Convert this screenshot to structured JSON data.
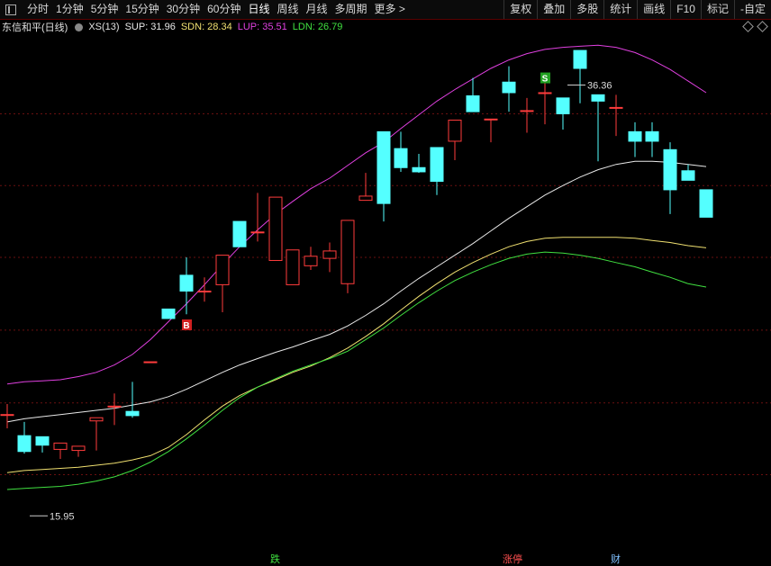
{
  "toolbar": {
    "periods": [
      "分时",
      "1分钟",
      "5分钟",
      "15分钟",
      "30分钟",
      "60分钟",
      "日线",
      "周线",
      "月线",
      "多周期",
      "更多 >"
    ],
    "active_index": 6,
    "right_buttons": [
      "复权",
      "叠加",
      "多股",
      "统计",
      "画线",
      "F10",
      "标记",
      "-自定"
    ]
  },
  "info": {
    "stock": "东信和平(日线)",
    "indicator": "XS(13)",
    "sup": "SUP: 31.96",
    "sdn": "SDN: 28.34",
    "lup": "LUP: 35.51",
    "ldn": "LDN: 26.79",
    "colors": {
      "sup": "#e8e8e8",
      "sdn": "#f0e070",
      "lup": "#e040e0",
      "ldn": "#40e040"
    }
  },
  "bottom_marks": {
    "a": "跌",
    "b": "涨停",
    "c": "财"
  },
  "chart_data": {
    "type": "candlestick",
    "ylim": [
      14.3,
      38.6
    ],
    "candles": [
      {
        "o": 20.75,
        "h": 21.25,
        "l": 20.1,
        "c": 20.75
      },
      {
        "o": 19.75,
        "h": 20.4,
        "l": 18.9,
        "c": 19.0
      },
      {
        "o": 19.7,
        "h": 19.7,
        "l": 18.95,
        "c": 19.3
      },
      {
        "o": 19.1,
        "h": 19.4,
        "l": 18.65,
        "c": 19.4
      },
      {
        "o": 19.05,
        "h": 19.25,
        "l": 18.75,
        "c": 19.25
      },
      {
        "o": 20.45,
        "h": 20.45,
        "l": 19.05,
        "c": 20.6
      },
      {
        "o": 21.15,
        "h": 21.75,
        "l": 20.25,
        "c": 21.15
      },
      {
        "o": 20.9,
        "h": 22.3,
        "l": 20.6,
        "c": 20.7
      },
      {
        "o": 23.25,
        "h": 23.25,
        "l": 23.25,
        "c": 23.25
      },
      {
        "o": 25.75,
        "h": 25.75,
        "l": 25.3,
        "c": 25.3
      },
      {
        "o": 27.35,
        "h": 28.2,
        "l": 25.5,
        "c": 26.6
      },
      {
        "o": 26.6,
        "h": 27.25,
        "l": 26.1,
        "c": 26.6
      },
      {
        "o": 26.9,
        "h": 27.85,
        "l": 25.6,
        "c": 28.3
      },
      {
        "o": 29.9,
        "h": 29.9,
        "l": 28.7,
        "c": 28.7
      },
      {
        "o": 29.4,
        "h": 31.25,
        "l": 28.95,
        "c": 29.4
      },
      {
        "o": 28.05,
        "h": 28.05,
        "l": 28.05,
        "c": 31.05
      },
      {
        "o": 26.9,
        "h": 28.55,
        "l": 26.9,
        "c": 28.55
      },
      {
        "o": 27.8,
        "h": 28.7,
        "l": 27.6,
        "c": 28.25
      },
      {
        "o": 28.15,
        "h": 28.9,
        "l": 27.5,
        "c": 28.5
      },
      {
        "o": 26.95,
        "h": 29.9,
        "l": 26.5,
        "c": 29.95
      },
      {
        "o": 30.9,
        "h": 32.2,
        "l": 30.9,
        "c": 31.1
      },
      {
        "o": 34.15,
        "h": 34.15,
        "l": 29.9,
        "c": 30.75
      },
      {
        "o": 33.35,
        "h": 34.15,
        "l": 32.25,
        "c": 32.45
      },
      {
        "o": 32.45,
        "h": 33.1,
        "l": 32.2,
        "c": 32.25
      },
      {
        "o": 33.4,
        "h": 33.4,
        "l": 31.15,
        "c": 31.8
      },
      {
        "o": 33.7,
        "h": 34.55,
        "l": 32.8,
        "c": 34.7
      },
      {
        "o": 35.85,
        "h": 36.7,
        "l": 35.85,
        "c": 35.1
      },
      {
        "o": 34.75,
        "h": 34.75,
        "l": 33.65,
        "c": 34.75
      },
      {
        "o": 36.5,
        "h": 37.25,
        "l": 35.1,
        "c": 36.0
      },
      {
        "o": 35.15,
        "h": 35.75,
        "l": 34.1,
        "c": 35.15
      },
      {
        "o": 36.0,
        "h": 36.65,
        "l": 34.5,
        "c": 36.0
      },
      {
        "o": 35.75,
        "h": 35.75,
        "l": 34.25,
        "c": 35.0
      },
      {
        "o": 38.0,
        "h": 38.0,
        "l": 35.5,
        "c": 37.15
      },
      {
        "o": 35.9,
        "h": 35.9,
        "l": 32.75,
        "c": 35.6
      },
      {
        "o": 35.3,
        "h": 35.9,
        "l": 33.95,
        "c": 35.3
      },
      {
        "o": 34.15,
        "h": 34.6,
        "l": 32.95,
        "c": 33.7
      },
      {
        "o": 34.15,
        "h": 34.6,
        "l": 32.95,
        "c": 33.7
      },
      {
        "o": 33.3,
        "h": 33.65,
        "l": 30.25,
        "c": 31.4
      },
      {
        "o": 32.3,
        "h": 32.6,
        "l": 31.85,
        "c": 31.85
      },
      {
        "o": 31.4,
        "h": 31.4,
        "l": 30.1,
        "c": 30.1
      }
    ],
    "candle_x": [
      8,
      27,
      47,
      67,
      87,
      107,
      127,
      147,
      167,
      187,
      207,
      227,
      247,
      266,
      286,
      306,
      325,
      345,
      366,
      386,
      406,
      426,
      445,
      465,
      485,
      505,
      525,
      545,
      565,
      585,
      605,
      625,
      644,
      664,
      684,
      705,
      724,
      744,
      764,
      784
    ],
    "sup": [
      20.4,
      20.55,
      20.65,
      20.75,
      20.85,
      20.95,
      21.05,
      21.2,
      21.35,
      21.6,
      21.95,
      22.35,
      22.75,
      23.1,
      23.4,
      23.7,
      23.95,
      24.25,
      24.55,
      24.95,
      25.45,
      26.0,
      26.6,
      27.2,
      27.75,
      28.3,
      28.85,
      29.45,
      30.05,
      30.6,
      31.15,
      31.6,
      32.0,
      32.35,
      32.6,
      32.75,
      32.75,
      32.7,
      32.6,
      32.5
    ],
    "sdn": [
      18.0,
      18.1,
      18.15,
      18.2,
      18.25,
      18.35,
      18.45,
      18.6,
      18.8,
      19.2,
      19.8,
      20.5,
      21.15,
      21.65,
      22.05,
      22.4,
      22.75,
      23.05,
      23.45,
      23.9,
      24.45,
      25.05,
      25.7,
      26.35,
      26.95,
      27.5,
      27.95,
      28.35,
      28.7,
      28.95,
      29.1,
      29.15,
      29.15,
      29.15,
      29.15,
      29.1,
      29.0,
      28.9,
      28.75,
      28.65
    ],
    "lup": [
      22.2,
      22.3,
      22.35,
      22.4,
      22.55,
      22.75,
      23.1,
      23.6,
      24.3,
      25.15,
      26.0,
      26.9,
      27.85,
      28.7,
      29.5,
      30.25,
      30.85,
      31.45,
      31.95,
      32.55,
      33.15,
      33.65,
      34.3,
      34.95,
      35.6,
      36.15,
      36.65,
      37.15,
      37.55,
      37.85,
      38.05,
      38.15,
      38.2,
      38.25,
      38.15,
      37.9,
      37.55,
      37.1,
      36.55,
      36.0
    ],
    "ldn": [
      17.2,
      17.25,
      17.3,
      17.35,
      17.45,
      17.6,
      17.8,
      18.1,
      18.5,
      19.0,
      19.6,
      20.25,
      20.95,
      21.55,
      22.05,
      22.45,
      22.8,
      23.1,
      23.4,
      23.75,
      24.3,
      24.85,
      25.45,
      26.05,
      26.6,
      27.1,
      27.5,
      27.85,
      28.15,
      28.35,
      28.45,
      28.4,
      28.3,
      28.15,
      27.95,
      27.75,
      27.5,
      27.25,
      26.95,
      26.79
    ],
    "annotations": [
      {
        "text": "36.36",
        "value": 36.36,
        "candle": 32
      },
      {
        "text": "15.95",
        "value": 15.95,
        "candle": 2
      }
    ],
    "signals": [
      {
        "text": "B",
        "candle": 10,
        "value": 25.0,
        "color": "#d02020"
      },
      {
        "text": "S",
        "candle": 30,
        "value": 36.7,
        "color": "#20a020"
      }
    ],
    "grid_values": [
      35.0,
      31.6,
      28.2,
      24.75,
      21.3,
      17.9
    ]
  }
}
